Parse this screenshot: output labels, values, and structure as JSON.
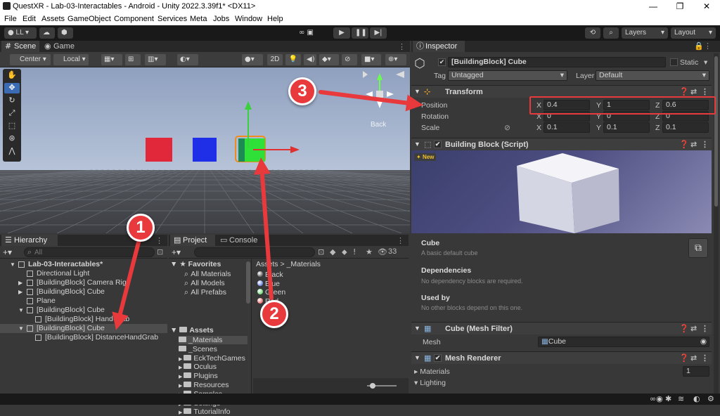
{
  "window": {
    "title": "QuestXR - Lab-03-Interactables - Android - Unity 2022.3.39f1* <DX11>",
    "minimize": "—",
    "maximize": "❐",
    "close": "✕"
  },
  "menu": [
    "File",
    "Edit",
    "Assets",
    "GameObject",
    "Component",
    "Services",
    "Meta",
    "Jobs",
    "Window",
    "Help"
  ],
  "toolbar": {
    "account": "LL",
    "layers_label": "Layers",
    "layout_label": "Layout"
  },
  "scene_tabs": {
    "scene": "Scene",
    "game": "Game"
  },
  "scene_toolbar": {
    "pivot": "Center",
    "space": "Local",
    "mode_2d": "2D"
  },
  "scene_view": {
    "persp_label": "Back",
    "colors": {
      "red_cube": "#e0283a",
      "blue_cube": "#1f2fe8",
      "green_cube": "#2ee038"
    }
  },
  "hierarchy": {
    "tab": "Hierarchy",
    "search_placeholder": "All",
    "rows": [
      {
        "label": "Lab-03-Interactables*",
        "indent": 0,
        "bold": true,
        "arrow": "▼"
      },
      {
        "label": "Directional Light",
        "indent": 1,
        "arrow": ""
      },
      {
        "label": "[BuildingBlock] Camera Rig",
        "indent": 1,
        "arrow": "▶"
      },
      {
        "label": "[BuildingBlock] Cube",
        "indent": 1,
        "arrow": "▶"
      },
      {
        "label": "Plane",
        "indent": 1,
        "arrow": ""
      },
      {
        "label": "[BuildingBlock] Cube",
        "indent": 1,
        "arrow": "▼"
      },
      {
        "label": "[BuildingBlock] HandGrab",
        "indent": 2,
        "arrow": ""
      },
      {
        "label": "[BuildingBlock] Cube",
        "indent": 1,
        "arrow": "▼",
        "selected": true
      },
      {
        "label": "[BuildingBlock] DistanceHandGrab",
        "indent": 2,
        "arrow": ""
      }
    ]
  },
  "project": {
    "tab_project": "Project",
    "tab_console": "Console",
    "count": "33",
    "favorites": {
      "title": "Favorites",
      "items": [
        "All Materials",
        "All Models",
        "All Prefabs"
      ]
    },
    "assets": {
      "title": "Assets",
      "items": [
        "_Materials",
        "_Scenes",
        "EckTechGames",
        "Oculus",
        "Plugins",
        "Resources",
        "Samples",
        "Settings",
        "TutorialInfo"
      ]
    },
    "breadcrumb": [
      "Assets",
      ">",
      "_Materials"
    ],
    "materials": [
      "Black",
      "Blue",
      "Green",
      "Red"
    ]
  },
  "inspector": {
    "tab": "Inspector",
    "object_name": "[BuildingBlock] Cube",
    "static_label": "Static",
    "tag_label": "Tag",
    "tag_value": "Untagged",
    "layer_label": "Layer",
    "layer_value": "Default",
    "transform": {
      "title": "Transform",
      "position": {
        "label": "Position",
        "x": "0.4",
        "y": "1",
        "z": "0.6"
      },
      "rotation": {
        "label": "Rotation",
        "x": "0",
        "y": "0",
        "z": "0"
      },
      "scale": {
        "label": "Scale",
        "x": "0.1",
        "y": "0.1",
        "z": "0.1"
      }
    },
    "building_block": {
      "title": "Building Block (Script)",
      "new_badge": "New",
      "name": "Cube",
      "desc": "A basic default cube",
      "deps_title": "Dependencies",
      "deps_desc": "No dependency blocks are required.",
      "used_title": "Used by",
      "used_desc": "No other blocks depend on this one."
    },
    "mesh_filter": {
      "title": "Cube (Mesh Filter)",
      "mesh_label": "Mesh",
      "mesh_value": "Cube"
    },
    "mesh_renderer": {
      "title": "Mesh Renderer",
      "materials_label": "Materials",
      "materials_count": "1",
      "lighting_label": "Lighting"
    }
  },
  "annotations": {
    "one": "1",
    "two": "2",
    "three": "3",
    "color": "#e8393c"
  }
}
